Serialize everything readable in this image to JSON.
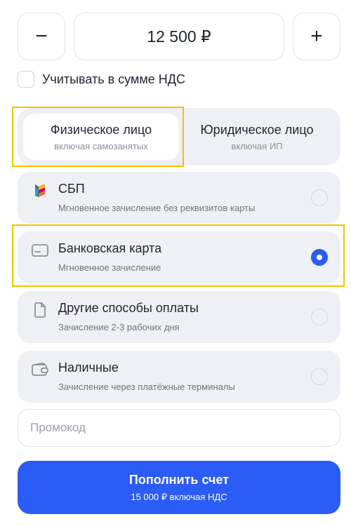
{
  "colors": {
    "accent": "#2b5cf5",
    "highlight": "#f2c300",
    "card_bg": "#eef0f5"
  },
  "stepper": {
    "minus": "−",
    "plus": "+",
    "amount": "12 500 ₽"
  },
  "vat": {
    "label": "Учитывать в сумме НДС",
    "checked": false
  },
  "entity_tabs": [
    {
      "title": "Физическое лицо",
      "subtitle": "включая самозанятых",
      "active": true
    },
    {
      "title": "Юридическое лицо",
      "subtitle": "включая ИП",
      "active": false
    }
  ],
  "payment_methods": [
    {
      "icon": "sbp-icon",
      "title": "СБП",
      "subtitle": "Мгновенное зачисление без реквизитов карты",
      "selected": false
    },
    {
      "icon": "card-icon",
      "title": "Банковская карта",
      "subtitle": "Мгновенное зачисление",
      "selected": true
    },
    {
      "icon": "document-icon",
      "title": "Другие способы оплаты",
      "subtitle": "Зачисление 2-3 рабочих дня",
      "selected": false
    },
    {
      "icon": "wallet-icon",
      "title": "Наличные",
      "subtitle": "Зачисление через платёжные терминалы",
      "selected": false
    }
  ],
  "promo": {
    "placeholder": "Промокод",
    "value": ""
  },
  "submit": {
    "title": "Пополнить счет",
    "subtitle": "15 000 ₽ включая НДС"
  }
}
